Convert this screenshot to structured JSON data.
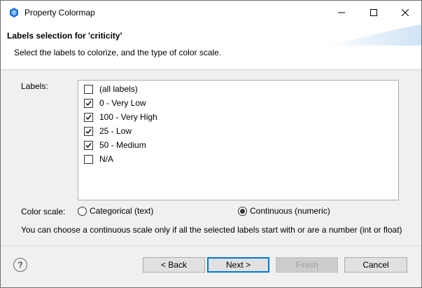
{
  "window": {
    "title": "Property Colormap"
  },
  "banner": {
    "title": "Labels selection for 'criticity'",
    "description": "Select the labels to colorize, and the type of color scale."
  },
  "labels": {
    "caption": "Labels:",
    "items": [
      {
        "label": "(all labels)",
        "checked": false
      },
      {
        "label": "0 - Very Low",
        "checked": true
      },
      {
        "label": "100 - Very High",
        "checked": true
      },
      {
        "label": "25 - Low",
        "checked": true
      },
      {
        "label": "50 - Medium",
        "checked": true
      },
      {
        "label": "N/A",
        "checked": false
      }
    ]
  },
  "color_scale": {
    "caption": "Color scale:",
    "options": [
      {
        "label": "Categorical (text)",
        "selected": false
      },
      {
        "label": "Continuous (numeric)",
        "selected": true
      }
    ],
    "hint": "You can choose a continuous scale only if all the selected labels start with or are a number (int or float)"
  },
  "footer": {
    "help": "?",
    "back": "< Back",
    "next": "Next >",
    "finish": "Finish",
    "cancel": "Cancel"
  },
  "colors": {
    "accent": "#0078d7",
    "app_icon": "#1e6fd9"
  }
}
